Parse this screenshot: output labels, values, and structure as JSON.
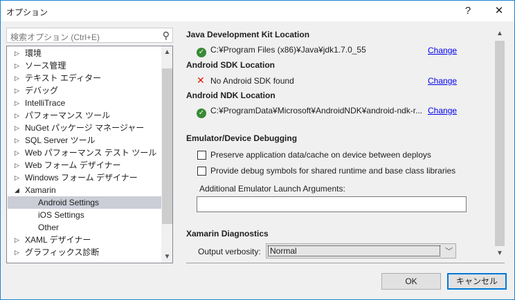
{
  "window": {
    "title": "オプション",
    "help": "?",
    "close": "✕"
  },
  "search": {
    "placeholder": "検索オプション (Ctrl+E)"
  },
  "tree": [
    {
      "label": "環境",
      "expand": "▷"
    },
    {
      "label": "ソース管理",
      "expand": "▷"
    },
    {
      "label": "テキスト エディター",
      "expand": "▷"
    },
    {
      "label": "デバッグ",
      "expand": "▷"
    },
    {
      "label": "IntelliTrace",
      "expand": "▷"
    },
    {
      "label": "パフォーマンス ツール",
      "expand": "▷"
    },
    {
      "label": "NuGet パッケージ マネージャー",
      "expand": "▷"
    },
    {
      "label": "SQL Server ツール",
      "expand": "▷"
    },
    {
      "label": "Web パフォーマンス テスト ツール",
      "expand": "▷"
    },
    {
      "label": "Web フォーム デザイナー",
      "expand": "▷"
    },
    {
      "label": "Windows フォーム デザイナー",
      "expand": "▷"
    },
    {
      "label": "Xamarin",
      "expand": "◢"
    },
    {
      "label": "Android Settings",
      "expand": ""
    },
    {
      "label": "iOS Settings",
      "expand": ""
    },
    {
      "label": "Other",
      "expand": ""
    },
    {
      "label": "XAML デザイナー",
      "expand": "▷"
    },
    {
      "label": "グラフィックス診断",
      "expand": "▷"
    }
  ],
  "settings": {
    "jdk": {
      "heading": "Java Development Kit Location",
      "path": "C:¥Program Files (x86)¥Java¥jdk1.7.0_55",
      "change": "Change"
    },
    "sdk": {
      "heading": "Android SDK Location",
      "path": "No Android SDK found",
      "change": "Change"
    },
    "ndk": {
      "heading": "Android NDK Location",
      "path": "C:¥ProgramData¥Microsoft¥AndroidNDK¥android-ndk-r...",
      "change": "Change"
    },
    "emu": {
      "heading": "Emulator/Device Debugging",
      "preserve": "Preserve application data/cache on device between deploys",
      "symbols": "Provide debug symbols for shared runtime and base class libraries",
      "args_label": "Additional Emulator Launch Arguments:",
      "args_value": ""
    },
    "diag": {
      "heading": "Xamarin Diagnostics",
      "verbosity_label": "Output verbosity:",
      "verbosity": "Normal"
    }
  },
  "buttons": {
    "ok": "OK",
    "cancel": "キャンセル"
  }
}
